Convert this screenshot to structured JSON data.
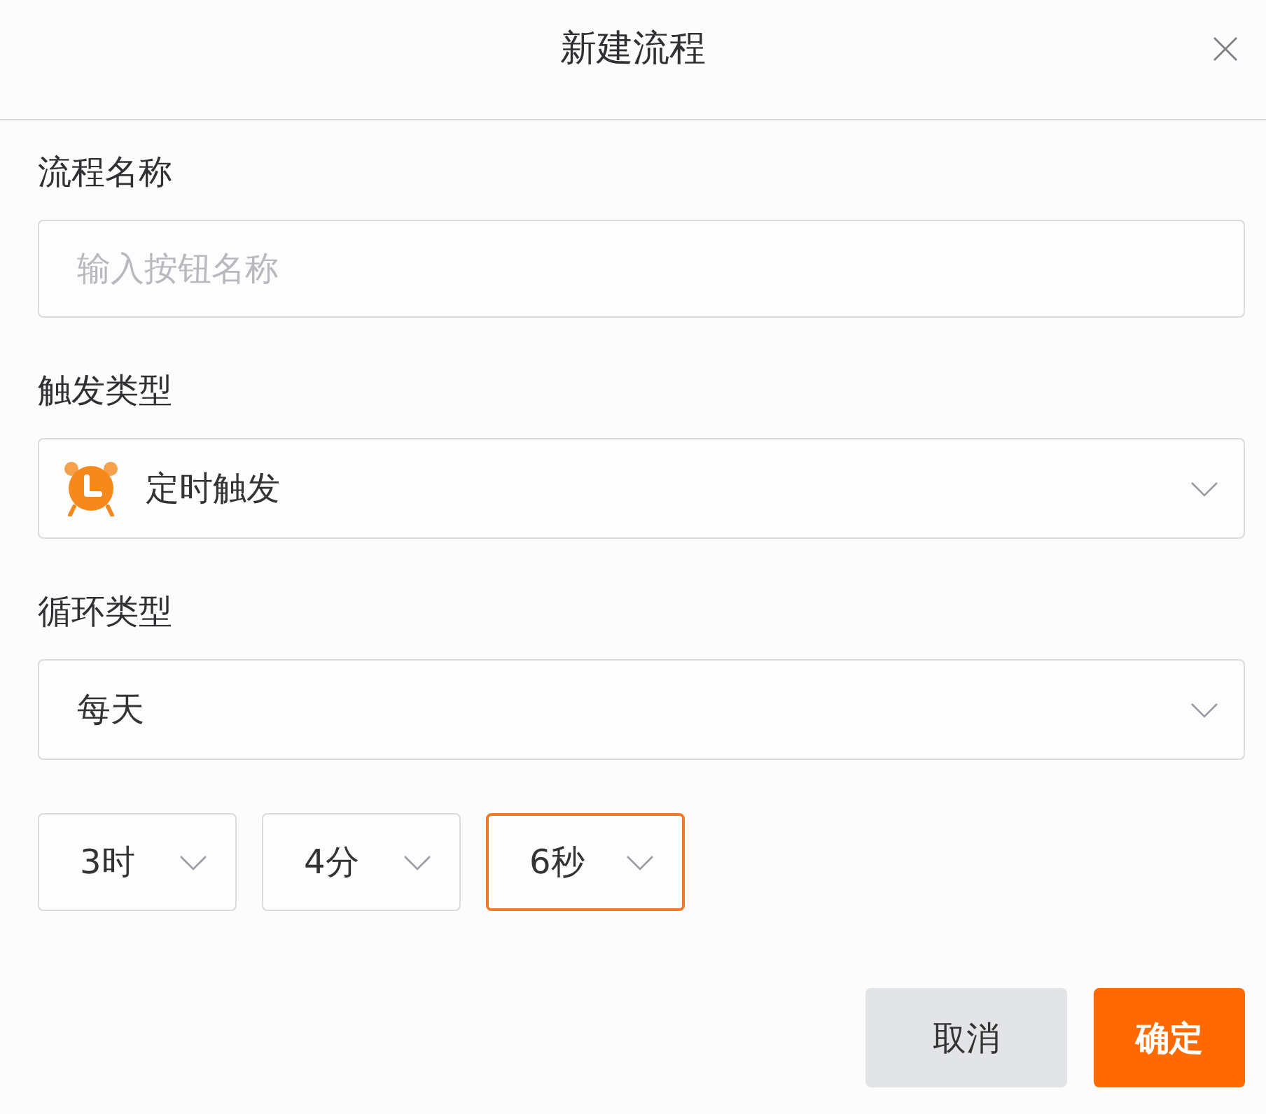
{
  "dialog": {
    "title": "新建流程"
  },
  "fields": [
    {
      "kind": "text",
      "label": "流程名称",
      "placeholder": "输入按钮名称"
    },
    {
      "kind": "icon-select",
      "label": "触发类型",
      "value": "定时触发"
    },
    {
      "kind": "select",
      "label": "循环类型",
      "value": "每天"
    }
  ],
  "time_selects": [
    {
      "value": "3时",
      "focused": false
    },
    {
      "value": "4分",
      "focused": false
    },
    {
      "value": "6秒",
      "focused": true
    }
  ],
  "buttons": [
    {
      "kind": "secondary",
      "label": "取消"
    },
    {
      "kind": "primary",
      "label": "确定"
    }
  ]
}
